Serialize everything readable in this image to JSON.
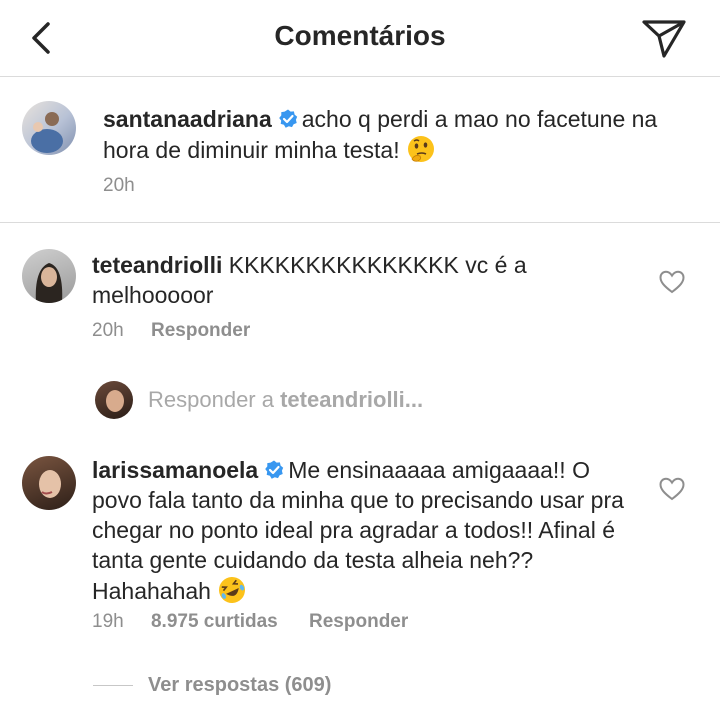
{
  "header": {
    "title": "Comentários"
  },
  "caption": {
    "username": "santanaadriana",
    "text": "acho q perdi a mao no facetune na hora de diminuir minha testa!",
    "time": "20h"
  },
  "comments": [
    {
      "username": "teteandriolli",
      "text": "KKKKKKKKKKKKKKK vc é a melhooooor",
      "time": "20h",
      "reply_label": "Responder"
    },
    {
      "username": "larissamanoela",
      "text": "Me ensinaaaaa amigaaaa!! O povo fala tanto da minha que to precisando usar pra chegar no ponto ideal pra agradar a todos!! Afinal é tanta gente cuidando da testa alheia neh?? Hahahahah",
      "time": "19h",
      "likes": "8.975 curtidas",
      "reply_label": "Responder"
    }
  ],
  "reply_prompt": {
    "prefix": "Responder a ",
    "username": "teteandriolli..."
  },
  "view_replies": "Ver respostas (609)",
  "colors": {
    "verified": "#3897f0",
    "secondary_text": "#8e8e8e",
    "divider": "#dbdbdb"
  },
  "icons": [
    "back-arrow-icon",
    "send-icon",
    "verified-badge-icon",
    "heart-icon",
    "thinking-face-emoji",
    "rofl-emoji"
  ]
}
